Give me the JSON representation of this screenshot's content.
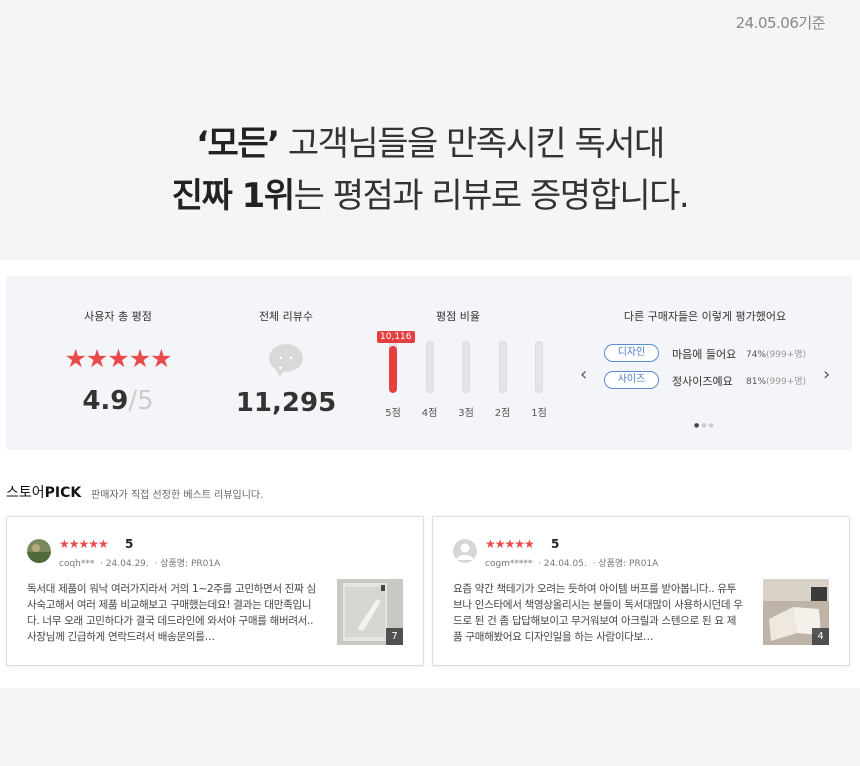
{
  "date_label": "24.05.06기준",
  "headline": {
    "line1_bold": "‘모든’",
    "line1_rest": " 고객님들을 만족시킨 독서대",
    "line2_bold": "진짜 1위",
    "line2_rest": "는 평점과 리뷰로 증명합니다."
  },
  "stats": {
    "rating_title": "사용자 총 평점",
    "rating_stars": "★★★★★",
    "rating_value": "4.9",
    "rating_max": "/5",
    "reviews_title": "전체 리뷰수",
    "reviews_icon": "chat-bubble-icon",
    "reviews_count": "11,295",
    "ratio_title": "평점 비율",
    "ratio_badge": "10,116",
    "ratio_bars": [
      {
        "label": "5점",
        "fraction": 0.9
      },
      {
        "label": "4점",
        "fraction": 0.0
      },
      {
        "label": "3점",
        "fraction": 0.0
      },
      {
        "label": "2점",
        "fraction": 0.0
      },
      {
        "label": "1점",
        "fraction": 0.0
      }
    ],
    "eval_title": "다른 구매자들은 이렇게 평가했어요",
    "eval_rows": [
      {
        "tag": "디자인",
        "text": "마음에 들어요",
        "pct": "74%",
        "count": "(999+명)"
      },
      {
        "tag": "사이즈",
        "text": "정사이즈예요",
        "pct": "81%",
        "count": "(999+명)"
      }
    ],
    "pager": "●●●"
  },
  "pick": {
    "title_pre": "스토어",
    "title_bold": "PICK",
    "subtitle": "판매자가 직접 선정한 베스트 리뷰입니다."
  },
  "cards": [
    {
      "stars": "★★★★★",
      "score": "5",
      "user": "coqh***",
      "date": "24.04.29.",
      "product": "상품명: PR01A",
      "body": "독서대 제품이 워낙 여러가지라서 거의 1~2주를 고민하면서 진짜 심사숙고해서 여러 제품 비교해보고 구매했는데요! 결과는 대만족입니다. 너무 오래 고민하다가 결국 데드라인에 와서야 구매를 해버려서.. 사장님께 긴급하게 연락드려서 배송문의를…",
      "photo_count": "7"
    },
    {
      "stars": "★★★★★",
      "score": "5",
      "user": "cogm*****",
      "date": "24.04.05.",
      "product": "상품명: PR01A",
      "body": "요즘 약간 책테기가 오려는 듯하여 아이템 버프를 받아봅니다.. 유투브나 인스타에서 책영상올리시는 분들이 독서대많이 사용하시던데 우드로 된 건 좀 답답해보이고 무거워보여 아크릴과 스텐으로 된 요 제품 구매해봤어요 디자인일을 하는 사람이다보…",
      "photo_count": "4"
    }
  ]
}
